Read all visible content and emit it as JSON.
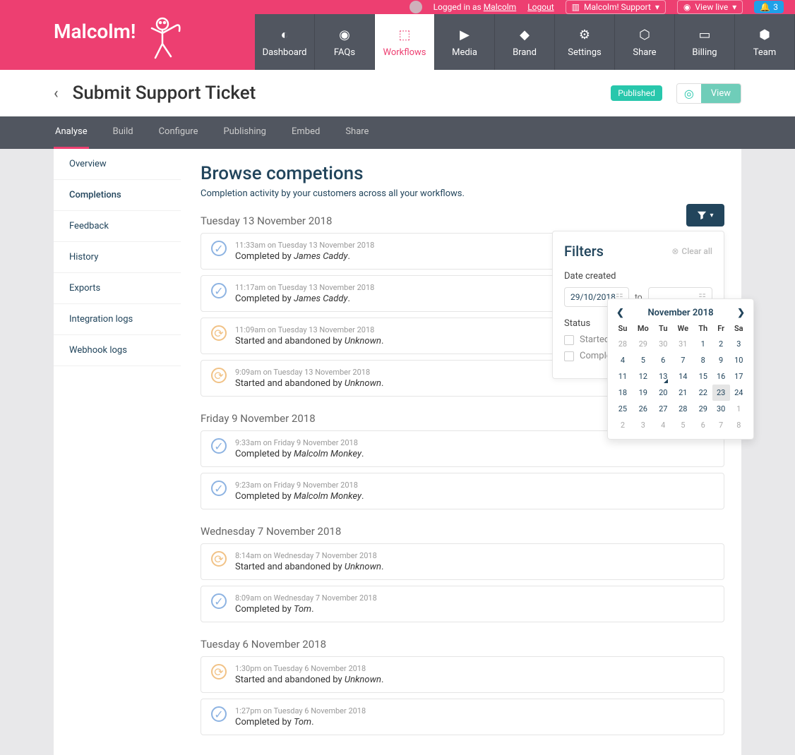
{
  "topbar": {
    "logged_in": "Logged in as",
    "user": "Malcolm",
    "logout": "Logout",
    "instance": "Malcolm! Support",
    "view_live": "View live",
    "notif_count": "3"
  },
  "brand": "Malcolm!",
  "nav": [
    {
      "label": "Dashboard"
    },
    {
      "label": "FAQs"
    },
    {
      "label": "Workflows"
    },
    {
      "label": "Media"
    },
    {
      "label": "Brand"
    },
    {
      "label": "Settings"
    },
    {
      "label": "Share"
    },
    {
      "label": "Billing"
    },
    {
      "label": "Team"
    }
  ],
  "subheader": {
    "title": "Submit Support Ticket",
    "published": "Published",
    "view": "View"
  },
  "tabs": [
    "Analyse",
    "Build",
    "Configure",
    "Publishing",
    "Embed",
    "Share"
  ],
  "sidebar": [
    "Overview",
    "Completions",
    "Feedback",
    "History",
    "Exports",
    "Integration logs",
    "Webhook logs"
  ],
  "page": {
    "title": "Browse competions",
    "subtitle": "Completion activity by your customers across all your workflows."
  },
  "filters": {
    "title": "Filters",
    "clear": "Clear all",
    "date_label": "Date created",
    "from": "29/10/2018",
    "to_label": "to",
    "status_label": "Status",
    "opt1": "Started, but not completed",
    "opt2": "Completed"
  },
  "datepicker": {
    "month": "November 2018",
    "dow": [
      "Su",
      "Mo",
      "Tu",
      "We",
      "Th",
      "Fr",
      "Sa"
    ],
    "rows": [
      [
        {
          "d": "28",
          "o": true
        },
        {
          "d": "29",
          "o": true
        },
        {
          "d": "30",
          "o": true
        },
        {
          "d": "31",
          "o": true
        },
        {
          "d": "1"
        },
        {
          "d": "2"
        },
        {
          "d": "3"
        }
      ],
      [
        {
          "d": "4"
        },
        {
          "d": "5"
        },
        {
          "d": "6"
        },
        {
          "d": "7"
        },
        {
          "d": "8"
        },
        {
          "d": "9"
        },
        {
          "d": "10"
        }
      ],
      [
        {
          "d": "11"
        },
        {
          "d": "12"
        },
        {
          "d": "13",
          "m": true
        },
        {
          "d": "14"
        },
        {
          "d": "15"
        },
        {
          "d": "16"
        },
        {
          "d": "17"
        }
      ],
      [
        {
          "d": "18"
        },
        {
          "d": "19"
        },
        {
          "d": "20"
        },
        {
          "d": "21"
        },
        {
          "d": "22"
        },
        {
          "d": "23",
          "s": true
        },
        {
          "d": "24"
        }
      ],
      [
        {
          "d": "25"
        },
        {
          "d": "26"
        },
        {
          "d": "27"
        },
        {
          "d": "28"
        },
        {
          "d": "29"
        },
        {
          "d": "30"
        },
        {
          "d": "1",
          "o": true
        }
      ],
      [
        {
          "d": "2",
          "o": true
        },
        {
          "d": "3",
          "o": true
        },
        {
          "d": "4",
          "o": true
        },
        {
          "d": "5",
          "o": true
        },
        {
          "d": "6",
          "o": true
        },
        {
          "d": "7",
          "o": true
        },
        {
          "d": "8",
          "o": true
        }
      ]
    ]
  },
  "days": [
    {
      "header": "Tuesday 13 November 2018",
      "entries": [
        {
          "time": "11:33am on Tuesday 13 November 2018",
          "prefix": "Completed by ",
          "who": "James Caddy",
          "type": "completed"
        },
        {
          "time": "11:17am on Tuesday 13 November 2018",
          "prefix": "Completed by ",
          "who": "James Caddy",
          "type": "completed"
        },
        {
          "time": "11:09am on Tuesday 13 November 2018",
          "prefix": "Started and abandoned by ",
          "who": "Unknown",
          "type": "abandoned"
        },
        {
          "time": "9:09am on Tuesday 13 November 2018",
          "prefix": "Started and abandoned by ",
          "who": "Unknown",
          "type": "abandoned"
        }
      ]
    },
    {
      "header": "Friday 9 November 2018",
      "entries": [
        {
          "time": "9:33am on Friday 9 November 2018",
          "prefix": "Completed by ",
          "who": "Malcolm Monkey",
          "type": "completed"
        },
        {
          "time": "9:23am on Friday 9 November 2018",
          "prefix": "Completed by ",
          "who": "Malcolm Monkey",
          "type": "completed"
        }
      ]
    },
    {
      "header": "Wednesday 7 November 2018",
      "entries": [
        {
          "time": "8:14am on Wednesday 7 November 2018",
          "prefix": "Started and abandoned by ",
          "who": "Unknown",
          "type": "abandoned"
        },
        {
          "time": "8:09am on Wednesday 7 November 2018",
          "prefix": "Completed by ",
          "who": "Tom",
          "type": "completed"
        }
      ]
    },
    {
      "header": "Tuesday 6 November 2018",
      "entries": [
        {
          "time": "1:30pm on Tuesday 6 November 2018",
          "prefix": "Started and abandoned by ",
          "who": "Unknown",
          "type": "abandoned"
        },
        {
          "time": "1:27pm on Tuesday 6 November 2018",
          "prefix": "Completed by ",
          "who": "Tom",
          "type": "completed"
        }
      ]
    }
  ]
}
